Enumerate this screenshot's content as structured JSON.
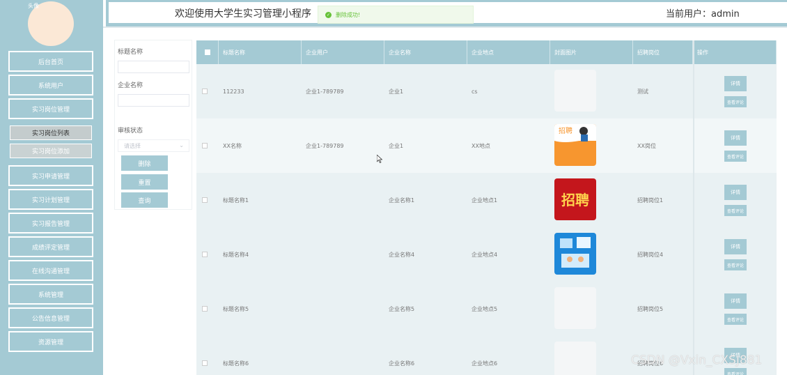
{
  "header": {
    "welcome": "欢迎使用大学生实习管理小程序",
    "current_user_label": "当前用户：admin",
    "toast": "删除成功!",
    "avatar_alt": "头像"
  },
  "sidebar": {
    "items": [
      {
        "label": "后台首页"
      },
      {
        "label": "系统用户"
      },
      {
        "label": "实习岗位管理"
      },
      {
        "label": "实习岗位列表"
      },
      {
        "label": "实习岗位添加"
      },
      {
        "label": "实习申请管理"
      },
      {
        "label": "实习计划管理"
      },
      {
        "label": "实习报告管理"
      },
      {
        "label": "成绩评定管理"
      },
      {
        "label": "在线沟通管理"
      },
      {
        "label": "系统管理"
      },
      {
        "label": "公告信息管理"
      },
      {
        "label": "资源管理"
      }
    ]
  },
  "filter": {
    "title_label": "标题名称",
    "company_label": "企业名称",
    "status_label": "审核状态",
    "status_placeholder": "请选择",
    "delete_btn": "删除",
    "reset_btn": "重置",
    "query_btn": "查询"
  },
  "table": {
    "headers": [
      "标题名称",
      "企业用户",
      "企业名称",
      "企业地点",
      "封面图片",
      "招聘岗位",
      "操作"
    ],
    "rows": [
      {
        "title": "112233",
        "user": "企业1-789789",
        "company": "企业1",
        "location": "cs",
        "image": "none",
        "position": "测试"
      },
      {
        "title": "XX名称",
        "user": "企业1-789789",
        "company": "企业1",
        "location": "XX地点",
        "image": "orange",
        "position": "XX岗位"
      },
      {
        "title": "标题名称1",
        "user": "",
        "company": "企业名称1",
        "location": "企业地点1",
        "image": "red",
        "position": "招聘岗位1"
      },
      {
        "title": "标题名称4",
        "user": "",
        "company": "企业名称4",
        "location": "企业地点4",
        "image": "blue",
        "position": "招聘岗位4"
      },
      {
        "title": "标题名称5",
        "user": "",
        "company": "企业名称5",
        "location": "企业地点5",
        "image": "none",
        "position": "招聘岗位5"
      },
      {
        "title": "标题名称6",
        "user": "",
        "company": "企业名称6",
        "location": "企业地点6",
        "image": "none",
        "position": "招聘岗位6"
      }
    ],
    "detail_btn": "详情",
    "review_btn": "查看评论",
    "image_text_red": "招聘",
    "image_text_orange": "招聘"
  },
  "watermark": "CSDN @Vxin_CXSJ881",
  "colors": {
    "accent": "#a4cad4",
    "success": "#67c23a"
  }
}
